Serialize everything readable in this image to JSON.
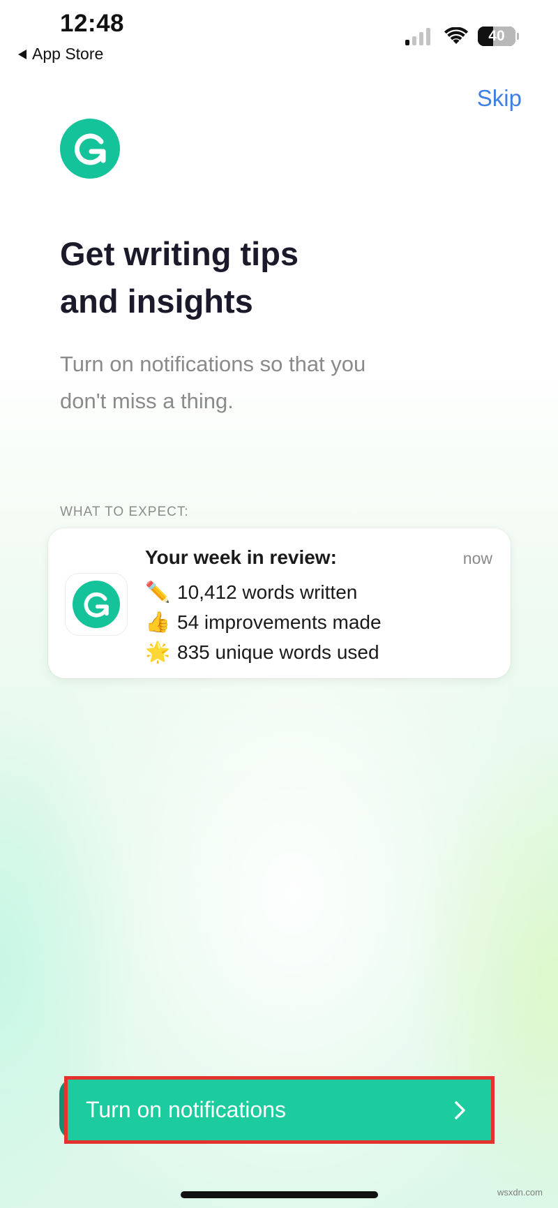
{
  "status_bar": {
    "time": "12:48",
    "back_label": "App Store",
    "battery": "40",
    "battery_level_percent": 40,
    "signal_bars_active": 1,
    "signal_bars_total": 4
  },
  "skip_label": "Skip",
  "headline": [
    "Get writing tips",
    "and insights"
  ],
  "subtitle": [
    "Turn on notifications so that you",
    "don't miss a thing."
  ],
  "expect_label": "WHAT TO EXPECT:",
  "notification": {
    "title": "Your week in review:",
    "time": "now",
    "lines": [
      {
        "emoji": "✏️",
        "text": "10,412 words written"
      },
      {
        "emoji": "👍",
        "text": "54 improvements made"
      },
      {
        "emoji": "🌟",
        "text": "835 unique words used"
      }
    ]
  },
  "cta": {
    "label": "Turn on notifications"
  },
  "watermark": "wsxdn.com",
  "colors": {
    "brand_green": "#15c39a",
    "button_green": "#1ccb9e",
    "link_blue": "#3f7ee3",
    "highlight_red": "#e3332e"
  },
  "icons": {
    "logo": "grammarly-logo-icon",
    "back": "back-triangle-icon",
    "signal": "cellular-signal-icon",
    "wifi": "wifi-icon",
    "battery": "battery-icon",
    "chevron": "chevron-right-icon"
  }
}
